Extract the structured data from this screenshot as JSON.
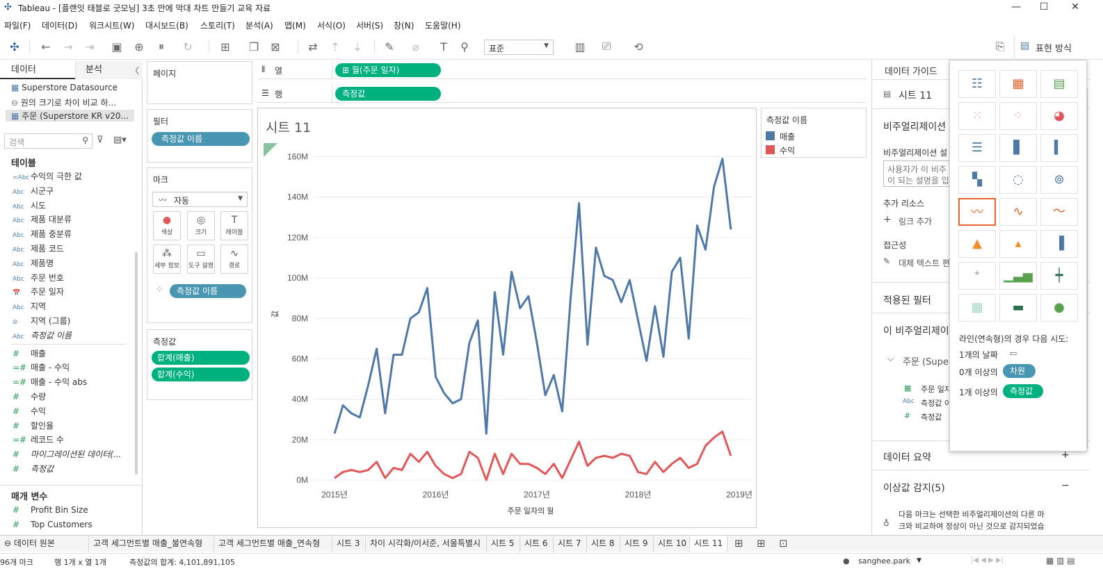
{
  "window": {
    "title": "Tableau - [플랜잇 태블로 굿모닝] 3초 만에 막대 차트 만들기 교육 자료",
    "minimize": "—",
    "maximize": "☐",
    "close": "✕"
  },
  "menu": [
    "파일(F)",
    "데이터(D)",
    "워크시트(W)",
    "대시보드(B)",
    "스토리(T)",
    "분석(A)",
    "맵(M)",
    "서식(O)",
    "서버(S)",
    "창(N)",
    "도움말(H)"
  ],
  "toolbar": {
    "fit_select": "표준",
    "showme_label": "표현 방식"
  },
  "left": {
    "tab_data": "데이터",
    "tab_analysis": "분석",
    "datasources": [
      "Superstore Datasource",
      "원의 크기로 차이 비교 하...",
      "주문 (Superstore KR v20..."
    ],
    "search_placeholder": "검색",
    "tables_header": "테이블",
    "dimensions": [
      {
        "type": "=Abc",
        "name": "수익의 극한 값"
      },
      {
        "type": "Abc",
        "name": "시군구"
      },
      {
        "type": "Abc",
        "name": "시도"
      },
      {
        "type": "Abc",
        "name": "제품 대분류"
      },
      {
        "type": "Abc",
        "name": "제품 중분류"
      },
      {
        "type": "Abc",
        "name": "제품 코드"
      },
      {
        "type": "Abc",
        "name": "제품명"
      },
      {
        "type": "Abc",
        "name": "주문 번호"
      },
      {
        "type": "📅",
        "name": "주문 일자"
      },
      {
        "type": "Abc",
        "name": "지역"
      },
      {
        "type": "⊘",
        "name": "지역 (그룹)"
      },
      {
        "type": "Abc",
        "name": "측정값 이름"
      }
    ],
    "measures": [
      {
        "type": "#",
        "name": "매출"
      },
      {
        "type": "=#",
        "name": "매출 - 수익"
      },
      {
        "type": "=#",
        "name": "매출 - 수익 abs"
      },
      {
        "type": "#",
        "name": "수량"
      },
      {
        "type": "#",
        "name": "수익"
      },
      {
        "type": "#",
        "name": "할인율"
      },
      {
        "type": "=#",
        "name": "레코드 수"
      },
      {
        "type": "#",
        "name": "마이그레이션된 데이터(..."
      },
      {
        "type": "#",
        "name": "측정값"
      }
    ],
    "params_header": "매개 변수",
    "params": [
      {
        "type": "#",
        "name": "Profit Bin Size"
      },
      {
        "type": "#",
        "name": "Top Customers"
      }
    ]
  },
  "shelves": {
    "pages": "페이지",
    "filters": "필터",
    "filter_pill": "측정값 이름",
    "marks": "마크",
    "mark_type": "자동",
    "mark_buttons": [
      "색상",
      "크기",
      "레이블",
      "세부 정보",
      "도구 설명",
      "경로"
    ],
    "color_pill": "측정값 이름",
    "measure_values": "측정값",
    "mv_pills": [
      "합계(매출)",
      "합계(수익)"
    ],
    "columns_label": "열",
    "rows_label": "행",
    "columns_pill": "월(주문 일자)",
    "rows_pill": "측정값"
  },
  "sheet": {
    "title": "시트 11"
  },
  "legend": {
    "title": "측정값 이름",
    "items": [
      {
        "name": "매출",
        "color": "#4e79a7"
      },
      {
        "name": "수익",
        "color": "#e15759"
      }
    ]
  },
  "chart_data": {
    "type": "line",
    "xlabel": "주문 일자의 월",
    "ylabel": "값",
    "x_ticks": [
      "2015년",
      "2016년",
      "2017년",
      "2018년",
      "2019년"
    ],
    "y_ticks": [
      "0M",
      "20M",
      "40M",
      "60M",
      "80M",
      "100M",
      "120M",
      "140M",
      "160M"
    ],
    "ylim": [
      0,
      165
    ],
    "x_start": [
      2015,
      1
    ],
    "series": [
      {
        "name": "매출",
        "color": "#4e79a7",
        "values": [
          23,
          37,
          33,
          31,
          47,
          65,
          33,
          62,
          62,
          80,
          83,
          95,
          51,
          43,
          38,
          40,
          68,
          79,
          23,
          93,
          62,
          103,
          85,
          91,
          68,
          42,
          52,
          34,
          90,
          137,
          67,
          115,
          101,
          99,
          88,
          99,
          79,
          59,
          86,
          61,
          103,
          110,
          70,
          126,
          114,
          145,
          159,
          124
        ]
      },
      {
        "name": "수익",
        "color": "#e15759",
        "values": [
          1,
          4,
          5,
          4,
          5,
          9,
          1,
          6,
          5,
          13,
          9,
          14,
          7,
          3,
          1,
          3,
          14,
          11,
          0,
          13,
          3,
          13,
          8,
          8,
          6,
          3,
          8,
          1,
          10,
          19,
          7,
          11,
          12,
          11,
          13,
          12,
          4,
          3,
          9,
          4,
          8,
          11,
          6,
          8,
          17,
          21,
          24,
          12
        ]
      }
    ]
  },
  "guide": {
    "title": "데이터 가이드",
    "sheet": "시트 11",
    "viz_header": "비주얼리제이션",
    "viz_desc_label": "비주얼리제이션 설",
    "viz_desc_placeholder_1": "사용자가 이 비주",
    "viz_desc_placeholder_2": "이 되는 설명을 입",
    "resources": "추가 리소스",
    "add_link": "링크 추가",
    "accessibility": "접근성",
    "alt_text": "대체 텍스트 편",
    "applied_filters": "적용된 필터",
    "this_viz": "이 비주얼리제이",
    "source": "주문 (Supe",
    "fields": [
      "주문 일자",
      "측정값 이",
      "측정값"
    ],
    "summary": "데이터 요약",
    "outliers": "이상값 감지(5)",
    "outlier_text_1": "다음 마크는 선택한 비주얼리제이션의 다른 마",
    "outlier_text_2": "크와 비교하여 정상이 아닌 것으로 감지되었습"
  },
  "showme": {
    "hint": "라인(연속형)의 경우 다음 시도:",
    "req1": "1개의 날짜",
    "req2_prefix": "0개 이상의",
    "req2_pill": "차원",
    "req3_prefix": "1개 이상의",
    "req3_pill": "측정값"
  },
  "tabs": [
    "데이터 원본",
    "고객 세그먼트별 매출_불연속형",
    "고객 세그먼트별 매출_연속형",
    "시트 3",
    "차이 시각화/이서준, 서울특별시",
    "시트 5",
    "시트 6",
    "시트 7",
    "시트 8",
    "시트 9",
    "시트 10",
    "시트 11"
  ],
  "status": {
    "marks": "96개 마크",
    "rows_cols": "행 1개 x 열 1개",
    "sum": "측정값의 합계: 4,101,891,105",
    "user": "sanghee.park"
  }
}
